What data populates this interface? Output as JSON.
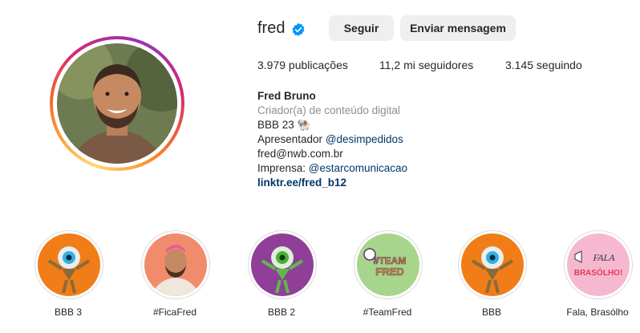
{
  "profile": {
    "username": "fred",
    "follow_label": "Seguir",
    "message_label": "Enviar mensagem"
  },
  "stats": {
    "posts": "3.979 publicações",
    "followers": "11,2 mi seguidores",
    "following": "3.145 seguindo"
  },
  "bio": {
    "name": "Fred Bruno",
    "category": "Criador(a) de conteúdo digital",
    "line1": "BBB 23 🐏",
    "line2_prefix": "Apresentador ",
    "line2_link": "@desimpedidos",
    "email": "fred@nwb.com.br",
    "press_prefix": "Imprensa: ",
    "press_link": "@estarcomunicacao",
    "website": "linktr.ee/fred_b12"
  },
  "highlights": [
    {
      "label": "BBB 3"
    },
    {
      "label": "#FicaFred"
    },
    {
      "label": "BBB 2"
    },
    {
      "label": "#TeamFred",
      "art_text": [
        "#TEAM",
        "FRED"
      ]
    },
    {
      "label": "BBB"
    },
    {
      "label": "Fala, Brasólho",
      "art_text": [
        "FALA",
        "BRASÓLHO!"
      ]
    }
  ],
  "colors": {
    "verified": "#0095f6",
    "link": "#00376b",
    "button_bg": "#efefef"
  }
}
